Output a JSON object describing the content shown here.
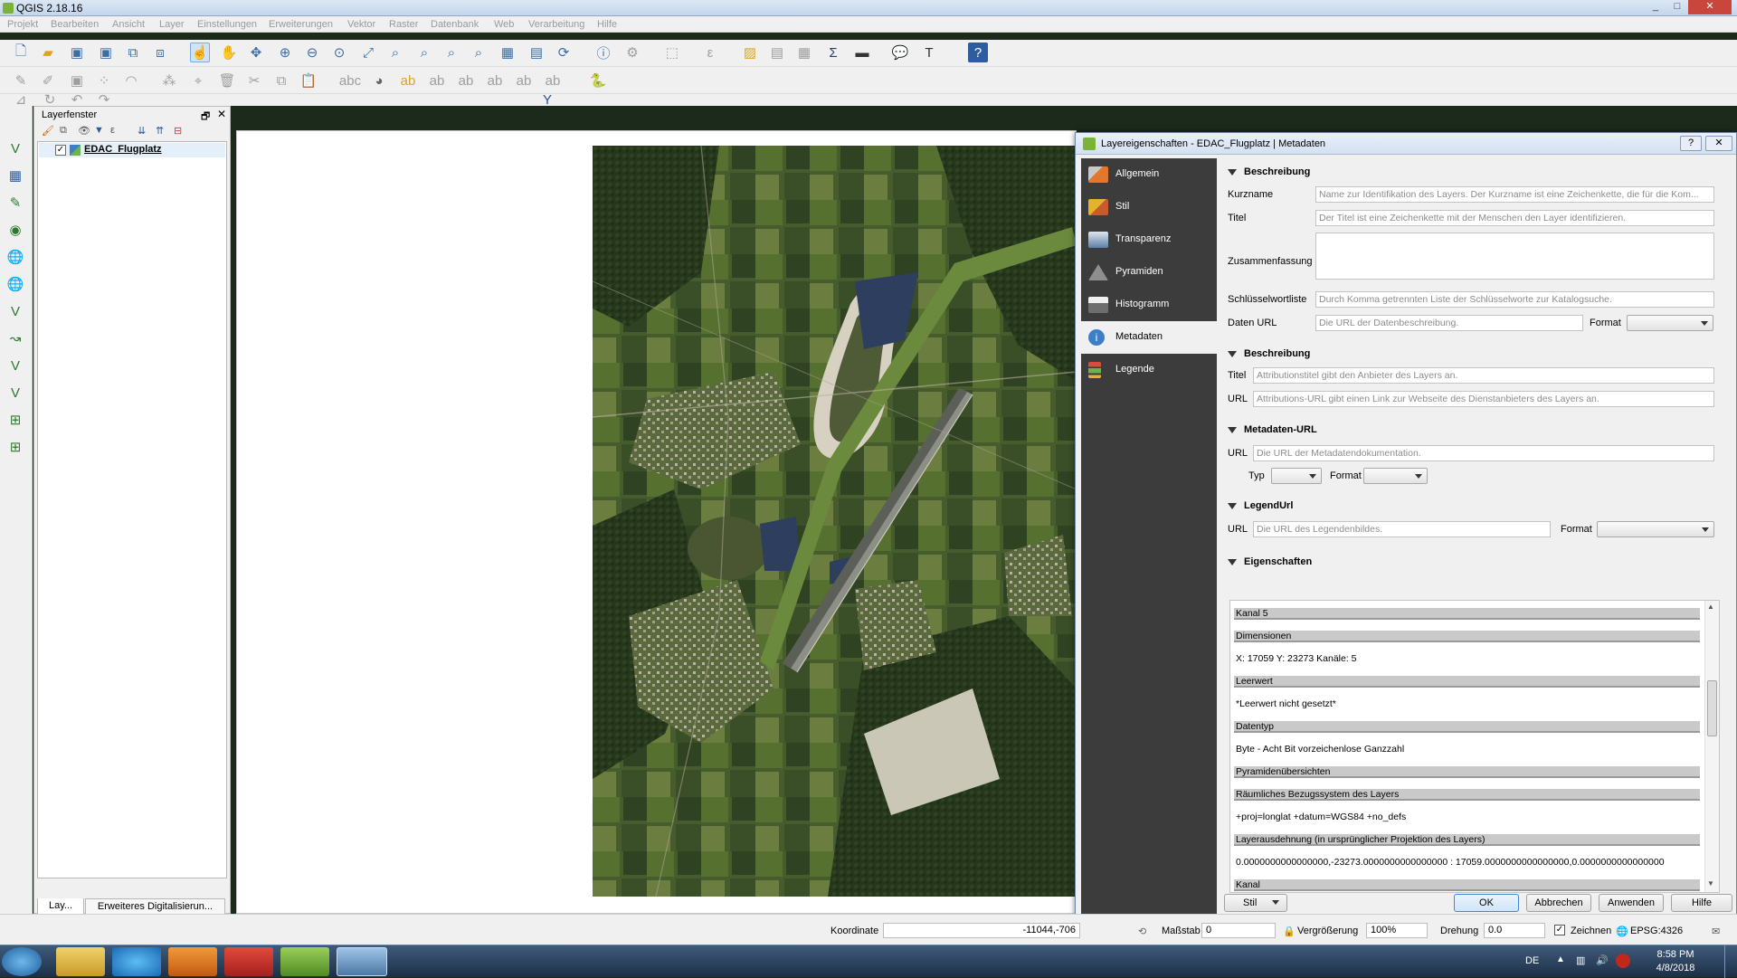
{
  "window": {
    "title": "QGIS 2.18.16",
    "min": "_",
    "max": "□",
    "close": "✕"
  },
  "menu": [
    "Projekt",
    "Bearbeiten",
    "Ansicht",
    "Layer",
    "Einstellungen",
    "Erweiterungen",
    "Vektor",
    "Raster",
    "Datenbank",
    "Web",
    "Verarbeitung",
    "Hilfe"
  ],
  "layer_panel": {
    "title": "Layerfenster",
    "layer_name": "EDAC_Flugplatz",
    "tab_layers": "Lay...",
    "tab_digitize": "Erweiteres Digitalisierun..."
  },
  "dialog": {
    "title": "Layereigenschaften - EDAC_Flugplatz | Metadaten",
    "help_q": "?",
    "close": "✕",
    "sidebar": [
      "Allgemein",
      "Stil",
      "Transparenz",
      "Pyramiden",
      "Histogramm",
      "Metadaten",
      "Legende"
    ],
    "active_tab": "Metadaten",
    "sections": {
      "beschreibung": "Beschreibung",
      "attribution": "Beschreibung",
      "metadaten_url": "Metadaten-URL",
      "legend_url": "LegendUrl",
      "eigenschaften": "Eigenschaften"
    },
    "fields": {
      "kurzname_label": "Kurzname",
      "kurzname_ph": "Name zur Identifikation des Layers. Der Kurzname ist eine Zeichenkette, die für die Kom...",
      "titel_label": "Titel",
      "titel_ph": "Der Titel ist eine Zeichenkette mit der Menschen den Layer identifizieren.",
      "zusammenfassung_label": "Zusammenfassung",
      "schluessel_label": "Schlüsselwortliste",
      "schluessel_ph": "Durch Komma getrennten Liste der Schlüsselworte zur Katalogsuche.",
      "daten_url_label": "Daten URL",
      "daten_url_ph": "Die URL der Datenbeschreibung.",
      "format_label": "Format",
      "attr_titel_label": "Titel",
      "attr_titel_ph": "Attributionstitel gibt den Anbieter des Layers an.",
      "attr_url_label": "URL",
      "attr_url_ph": "Attributions-URL gibt einen Link zur Webseite des Dienstanbieters des Layers an.",
      "meta_url_label": "URL",
      "meta_url_ph": "Die URL der Metadatendokumentation.",
      "typ_label": "Typ",
      "meta_format_label": "Format",
      "legend_url_label": "URL",
      "legend_url_ph": "Die URL des Legendenbildes.",
      "legend_format_label": "Format"
    },
    "properties": [
      {
        "text": "Kanal 5",
        "header": true
      },
      {
        "text": "Dimensionen",
        "header": true
      },
      {
        "text": "X: 17059 Y: 23273 Kanäle: 5",
        "header": false
      },
      {
        "text": "Leerwert",
        "header": true
      },
      {
        "text": "*Leerwert nicht gesetzt*",
        "header": false
      },
      {
        "text": "Datentyp",
        "header": true
      },
      {
        "text": "Byte - Acht Bit vorzeichenlose Ganzzahl",
        "header": false
      },
      {
        "text": "Pyramidenübersichten",
        "header": true
      },
      {
        "text": "Räumliches Bezugssystem des Layers",
        "header": true
      },
      {
        "text": "+proj=longlat +datum=WGS84 +no_defs",
        "header": false
      },
      {
        "text": "Layerausdehnung (in ursprünglicher Projektion des Layers)",
        "header": true
      },
      {
        "text": "0.0000000000000000,-23273.0000000000000000 : 17059.0000000000000000,0.0000000000000000",
        "header": false
      },
      {
        "text": "Kanal",
        "header": true
      }
    ],
    "buttons": {
      "stil": "Stil",
      "ok": "OK",
      "abbrechen": "Abbrechen",
      "anwenden": "Anwenden",
      "hilfe": "Hilfe"
    }
  },
  "statusbar": {
    "koordinate_label": "Koordinate",
    "koordinate_value": "-11044,-706",
    "massstab_label": "Maßstab",
    "massstab_value": "0",
    "vergroesserung_label": "Vergrößerung",
    "vergroesserung_value": "100%",
    "drehung_label": "Drehung",
    "drehung_value": "0.0",
    "zeichnen_label": "Zeichnen",
    "epsg": "EPSG:4326"
  },
  "taskbar": {
    "lang": "DE",
    "time": "8:58 PM",
    "date": "4/8/2018"
  },
  "colors": {
    "accent": "#3b8ad7",
    "sidebar_bg": "#3c3c3c",
    "qgis_green": "#7bb33a"
  }
}
